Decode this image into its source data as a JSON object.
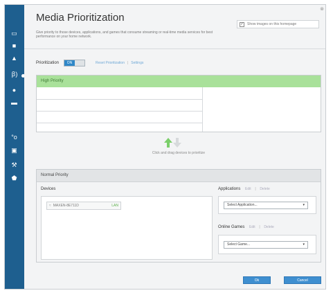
{
  "header": {
    "title": "Media Prioritization",
    "subtitle": "Give priority to those devices, applications, and games that consume streaming or real-time media services for best performance on your home network.",
    "show_images_label": "Show images on this homepage"
  },
  "prioritization": {
    "label": "Prioritization",
    "toggle_on": "ON",
    "reset_link": "Reset Prioritization",
    "settings_link": "Settings"
  },
  "high_priority": {
    "title": "High Priority"
  },
  "drag_hint": "Click and drag devices to prioritize",
  "normal_priority": {
    "title": "Normal Priority",
    "devices_label": "Devices",
    "device_name": "MAXEN-8E711D",
    "device_tag": "LAN"
  },
  "applications": {
    "label": "Applications",
    "edit": "Edit",
    "delete": "Delete",
    "select_placeholder": "Select Application..."
  },
  "online_games": {
    "label": "Online Games",
    "edit": "Edit",
    "delete": "Delete",
    "select_placeholder": "Select Game..."
  },
  "footer": {
    "ok": "Ok",
    "cancel": "Cancel"
  },
  "colors": {
    "sidebar": "#1e5f8f",
    "high_priority_band": "#a9e19a",
    "arrow_up": "#7bcf6a",
    "arrow_down": "#d7dadc",
    "accent": "#2e87c8"
  }
}
